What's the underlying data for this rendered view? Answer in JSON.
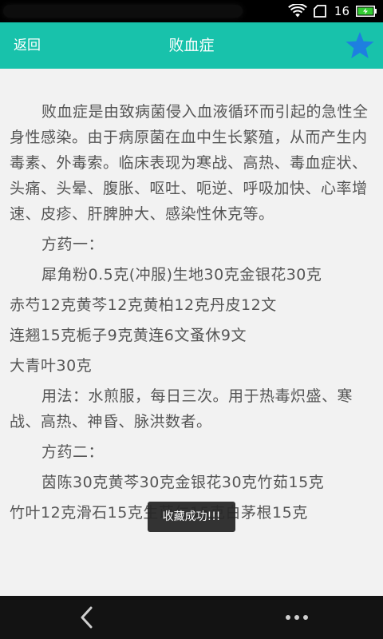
{
  "status_bar": {
    "time": "16",
    "icons": [
      "wifi-icon",
      "sim-icon",
      "battery-icon"
    ],
    "battery_color": "#33cc33"
  },
  "header": {
    "back_label": "返回",
    "title": "败血症",
    "favorite_icon": "star-icon",
    "background_color": "#18c2ab",
    "star_color": "#1e7fe0"
  },
  "article": {
    "paragraphs": [
      {
        "indent": true,
        "text": "败血症是由致病菌侵入血液循环而引起的急性全身性感染。由于病原菌在血中生长繁殖，从而产生内毒素、外毒索。临床表现为寒战、高热、毒血症状、头痛、头晕、腹胀、呕吐、呃逆、呼吸加快、心率增速、皮疹、肝脾肿大、感染性休克等。"
      },
      {
        "indent": true,
        "text": "方药一："
      },
      {
        "indent": true,
        "text": "犀角粉0.5克(冲服)生地30克金银花30克"
      },
      {
        "indent": false,
        "text": "赤芍12克黄芩12克黄柏12克丹皮12文"
      },
      {
        "indent": false,
        "text": "连翘15克栀子9克黄连6文蚤休9文"
      },
      {
        "indent": false,
        "text": "大青叶30克"
      },
      {
        "indent": true,
        "text": "用法：水煎服，每日三次。用于热毒炽盛、寒战、高热、神昏、脉洪数者。"
      },
      {
        "indent": true,
        "text": "方药二："
      },
      {
        "indent": true,
        "text": "茵陈30克黄芩30克金银花30克竹茹15克"
      },
      {
        "indent": false,
        "text": "竹叶12克滑石15克生苡仁15克白茅根15克"
      }
    ]
  },
  "toast": {
    "message": "收藏成功!!!"
  },
  "nav_bar": {
    "icons": [
      "back-chevron-icon",
      "more-dots-icon"
    ]
  }
}
